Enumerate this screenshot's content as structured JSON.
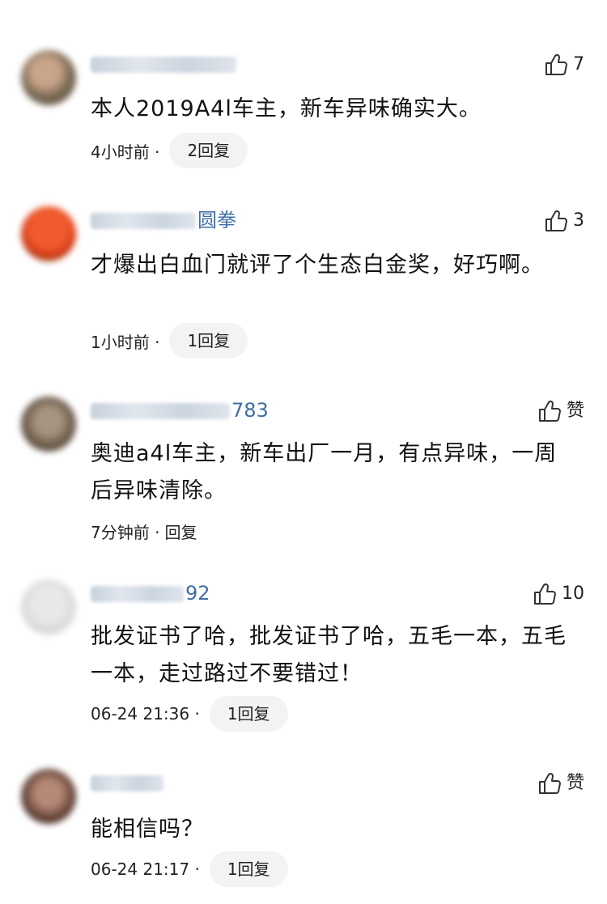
{
  "comments": [
    {
      "name_suffix": "",
      "likes": "7",
      "text": "本人2019A4l车主，新车异味确实大。",
      "time": "4小时前 ·",
      "reply": "2回复",
      "avatar_colors": [
        "#7a6a55",
        "#c9a58a"
      ]
    },
    {
      "name_suffix": "圆拳",
      "likes": "3",
      "text": "才爆出白血门就评了个生态白金奖，好巧啊。",
      "time": "1小时前 ·",
      "reply": "1回复",
      "avatar_colors": [
        "#e2401c",
        "#3a8a2e"
      ]
    },
    {
      "name_suffix": "783",
      "likes": "赞",
      "text": "奥迪a4l车主，新车出厂一月，有点异味，一周后异味清除。",
      "time": "7分钟前 ·",
      "reply": "回复",
      "avatar_colors": [
        "#6b5a4a",
        "#a89580"
      ]
    },
    {
      "name_suffix": "92",
      "likes": "10",
      "text": "批发证书了哈，批发证书了哈，五毛一本，五毛一本，走过路过不要错过！",
      "time": "06-24 21:36 ·",
      "reply": "1回复",
      "avatar_colors": [
        "#d5d5d8",
        "#e8e8ea"
      ]
    },
    {
      "name_suffix": "",
      "likes": "赞",
      "text": "能相信吗？",
      "time": "06-24 21:17 ·",
      "reply": "1回复",
      "avatar_colors": [
        "#5a3a30",
        "#b78a78"
      ]
    }
  ],
  "icons": {
    "like": "thumbs-up-icon"
  },
  "colors": {
    "name": "#3f6fa6",
    "pill": "#f2f3f5"
  }
}
